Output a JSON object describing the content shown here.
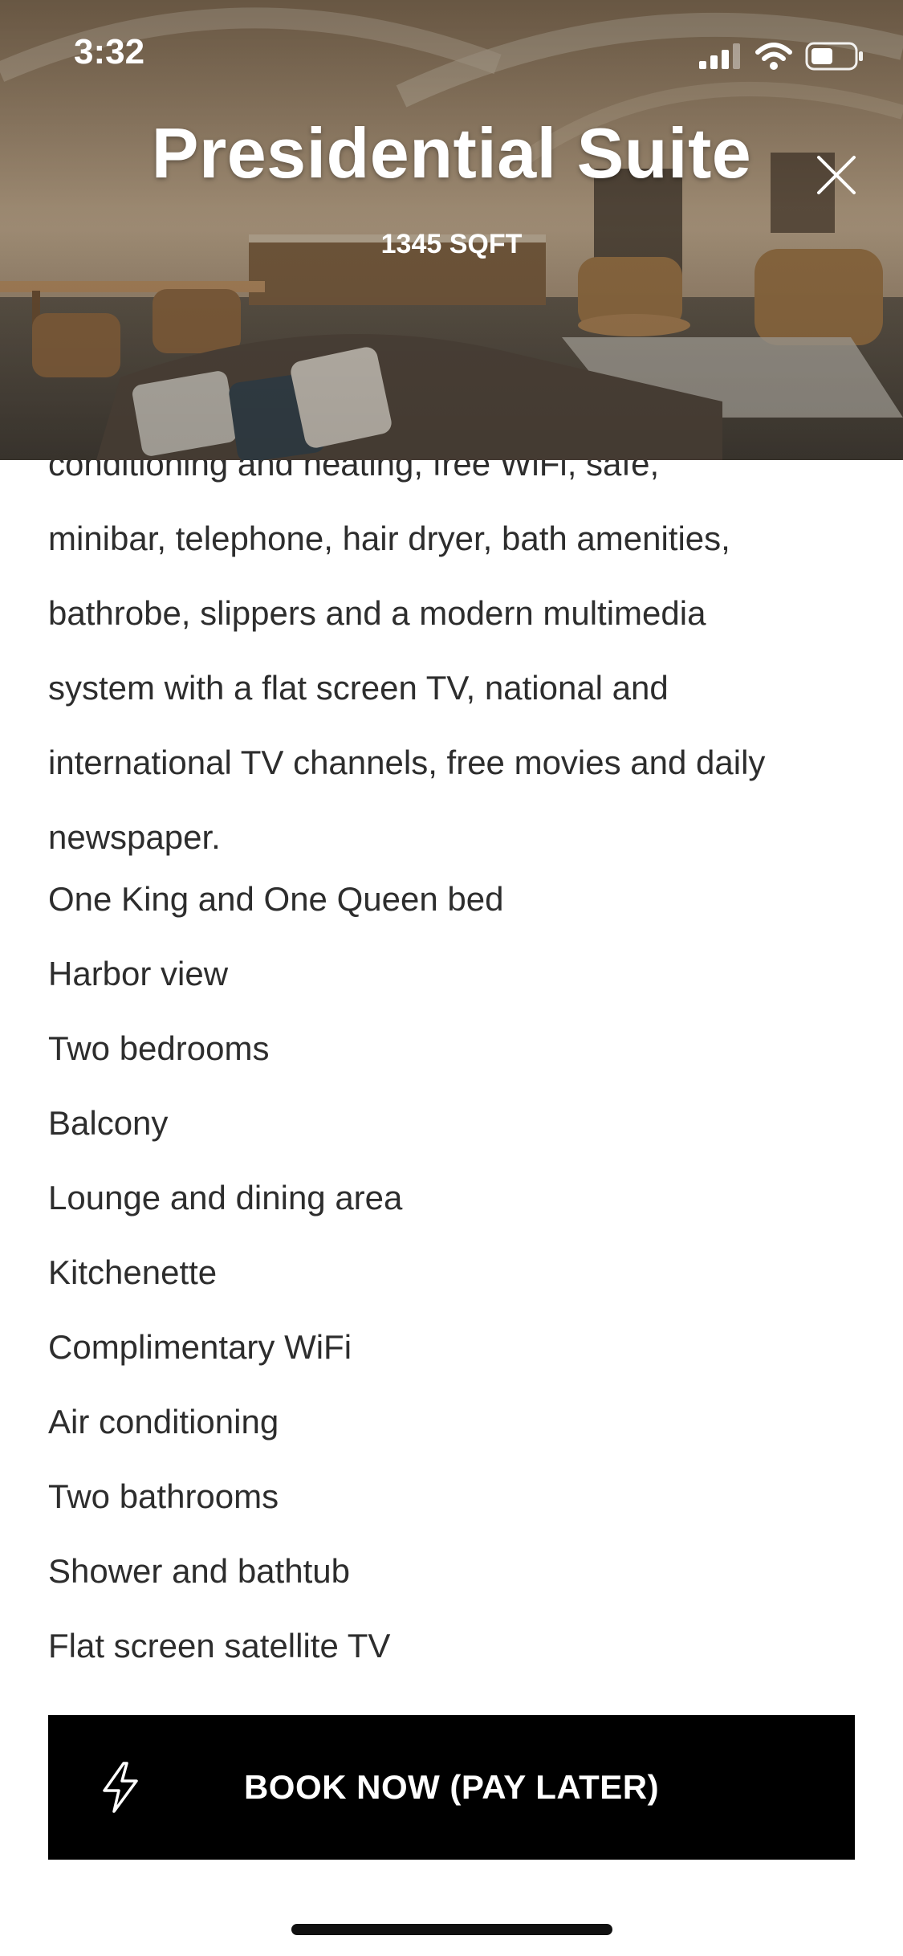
{
  "status_bar": {
    "time": "3:32",
    "icons": [
      "signal-icon",
      "wifi-icon",
      "battery-icon"
    ]
  },
  "header": {
    "title": "Presidential Suite",
    "subtitle": "1345 SQFT",
    "close_icon": "close-icon"
  },
  "description_lines": [
    "conditioning and heating, free WiFi, safe,",
    "minibar, telephone, hair dryer, bath amenities,",
    "bathrobe, slippers and a modern multimedia",
    "system with a flat screen TV, national and",
    "international TV channels, free movies and daily",
    "newspaper."
  ],
  "amenities": [
    "One King and One Queen bed",
    "Harbor view",
    "Two bedrooms",
    "Balcony",
    "Lounge and dining area",
    "Kitchenette",
    "Complimentary WiFi",
    "Air conditioning",
    "Two bathrooms",
    "Shower and bathtub",
    "Flat screen satellite TV"
  ],
  "cta": {
    "label": "BOOK NOW (PAY LATER)",
    "icon": "lightning-bolt-icon",
    "background": "#000000",
    "text_color": "#ffffff"
  }
}
